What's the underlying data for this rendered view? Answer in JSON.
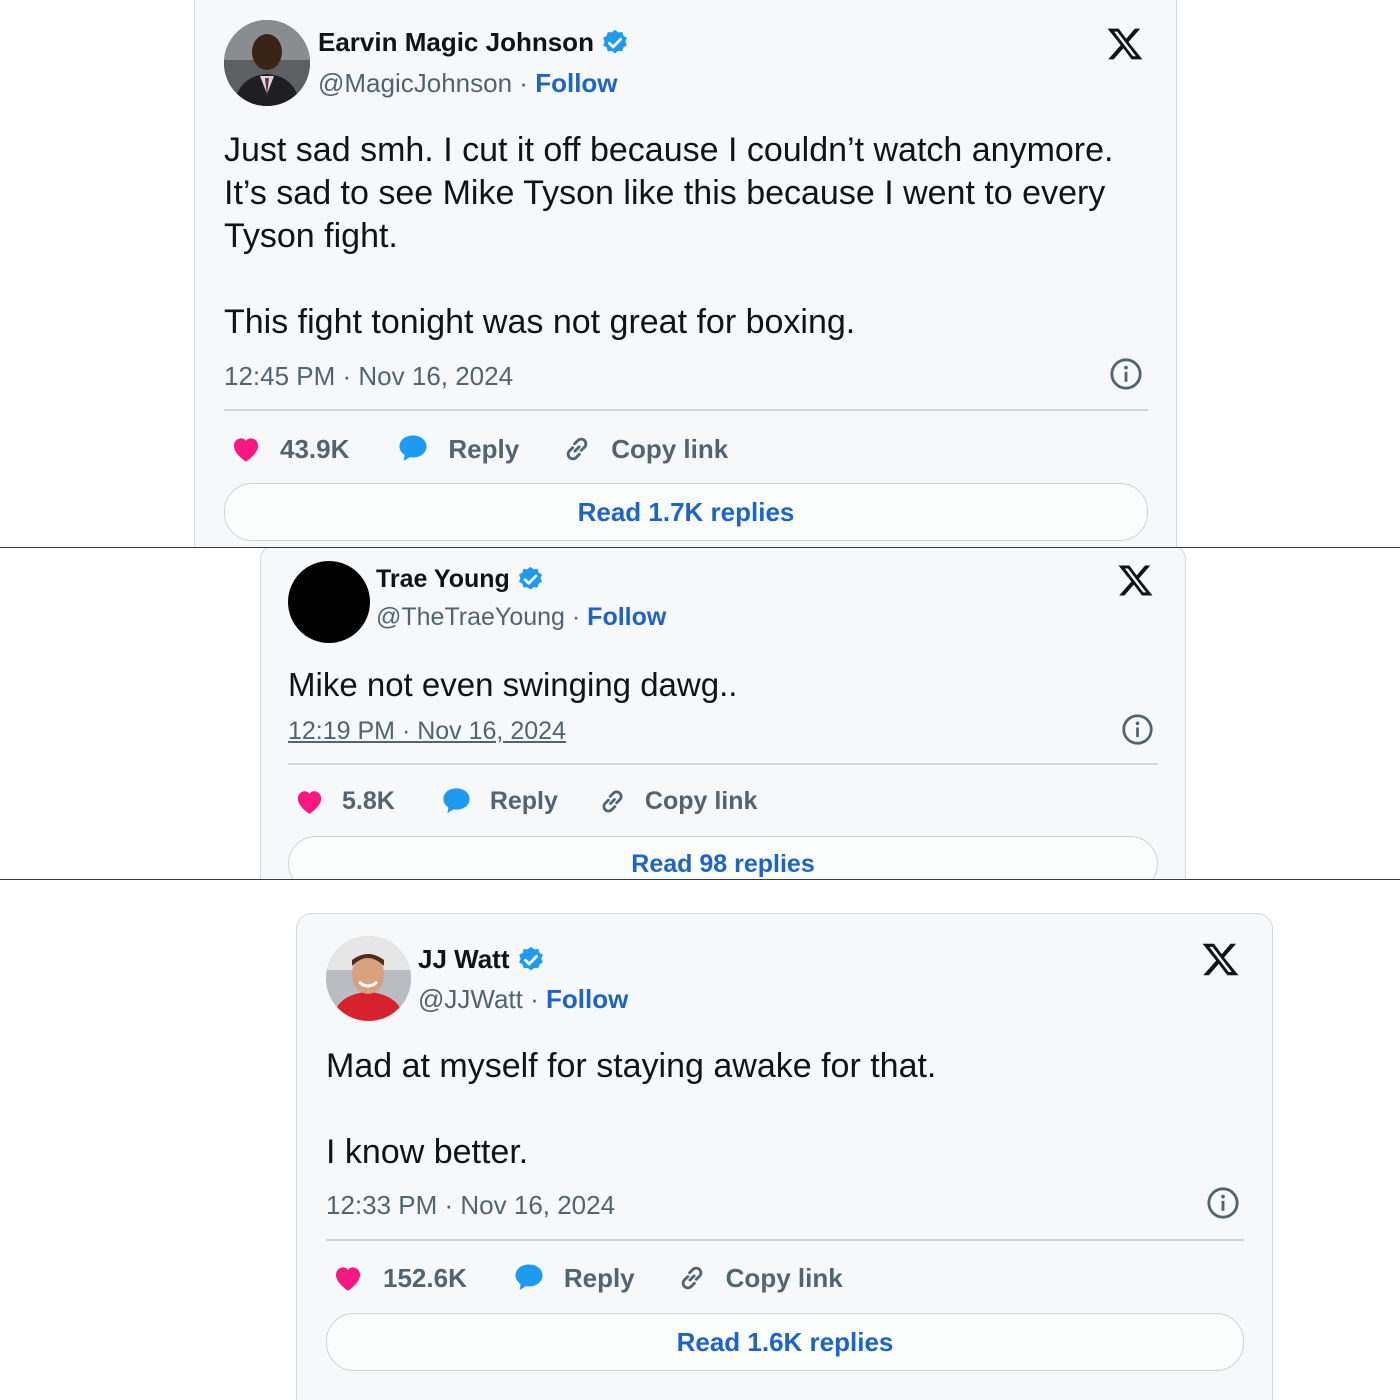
{
  "tweets": [
    {
      "name": "Earvin Magic Johnson",
      "handle": "@MagicJohnson",
      "separator": "·",
      "follow_label": "Follow",
      "body": [
        "Just sad smh. I cut it off because I couldn’t watch anymore. It’s sad to see Mike Tyson like this because I went to every Tyson fight.",
        "This fight tonight was not great for boxing."
      ],
      "timestamp": "12:45 PM · Nov 16, 2024",
      "likes": "43.9K",
      "reply_label": "Reply",
      "copy_label": "Copy link",
      "read_replies_label": "Read 1.7K replies"
    },
    {
      "name": "Trae Young",
      "handle": "@TheTraeYoung",
      "separator": "·",
      "follow_label": "Follow",
      "body": [
        "Mike not even swinging dawg.."
      ],
      "timestamp": "12:19 PM · Nov 16, 2024",
      "likes": "5.8K",
      "reply_label": "Reply",
      "copy_label": "Copy link",
      "read_replies_label": "Read 98 replies"
    },
    {
      "name": "JJ Watt",
      "handle": "@JJWatt",
      "separator": "·",
      "follow_label": "Follow",
      "body": [
        "Mad at myself for staying awake for that.",
        "I know better."
      ],
      "timestamp": "12:33 PM · Nov 16, 2024",
      "likes": "152.6K",
      "reply_label": "Reply",
      "copy_label": "Copy link",
      "read_replies_label": "Read 1.6K replies"
    }
  ],
  "icons": {
    "verified": "verified-badge-icon",
    "logo": "x-logo-icon",
    "info": "info-icon",
    "like": "heart-icon",
    "reply": "speech-bubble-icon",
    "copy": "link-icon"
  },
  "colors": {
    "accent_blue": "#1d64c8",
    "verified_blue": "#1d9bf0",
    "heart_pink": "#f91880",
    "text_primary": "#0f1419",
    "text_secondary": "#536471",
    "card_background": "#f7f8f9"
  }
}
